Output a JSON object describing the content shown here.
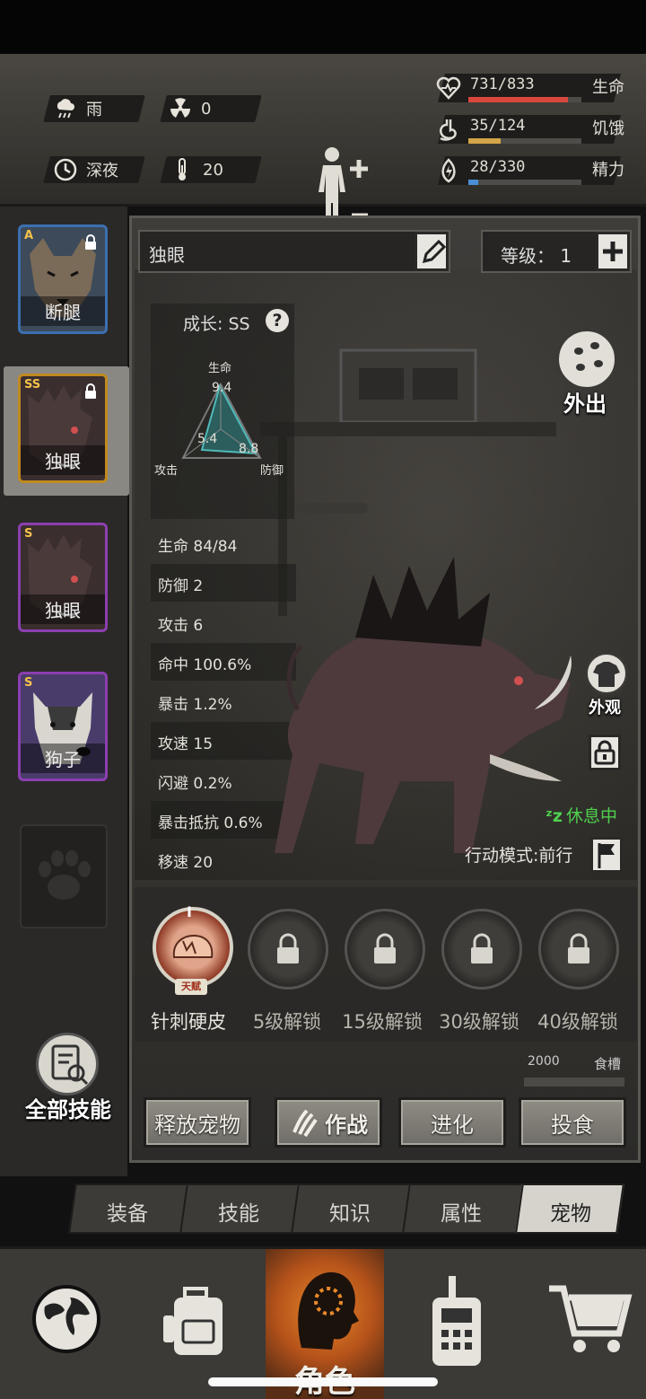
{
  "environment": {
    "weather": "雨",
    "radiation": "0",
    "time": "深夜",
    "temperature": "20"
  },
  "vitals": [
    {
      "value": "731/833",
      "label": "生命",
      "fraction": 0.8776,
      "color": "#d9473d",
      "icon": "heart-icon"
    },
    {
      "value": "35/124",
      "label": "饥饿",
      "fraction": 0.2823,
      "color": "#d4a548",
      "icon": "stomach-icon"
    },
    {
      "value": "28/330",
      "label": "精力",
      "fraction": 0.0848,
      "color": "#4a8fd6",
      "icon": "energy-icon"
    }
  ],
  "pets": [
    {
      "grade": "A",
      "name": "断腿",
      "border": "#3c6fb0",
      "bg": "#3c4a5a"
    },
    {
      "grade": "SS",
      "name": "独眼",
      "border": "#c08a20",
      "bg": "#3a2e2e"
    },
    {
      "grade": "S",
      "name": "独眼",
      "border": "#8c3fb0",
      "bg": "#3a2e2e"
    },
    {
      "grade": "S",
      "name": "狗子",
      "border": "#8c3fb0",
      "bg": "#4a3c6a"
    }
  ],
  "all_skills": "全部技能",
  "pet_name": "独眼",
  "level": "等级： 1",
  "growth": {
    "title": "成长: SS",
    "help": "?",
    "labels": {
      "top": "生命",
      "left": "攻击",
      "right": "防御"
    },
    "values": {
      "top": "9.4",
      "left": "5.4",
      "right": "8.8"
    }
  },
  "stats": [
    "生命 84/84",
    "防御 2",
    "攻击 6",
    "命中 100.6%",
    "暴击 1.2%",
    "攻速 15",
    "闪避 0.2%",
    "暴击抵抗 0.6%",
    "移速 20"
  ],
  "go_out": "外出",
  "appearance": "外观",
  "status": "休息中",
  "action_mode": "行动模式:前行",
  "skills": [
    {
      "label": "针刺硬皮",
      "tag": "天赋",
      "roman": "I"
    },
    {
      "label": "5级解锁"
    },
    {
      "label": "15级解锁"
    },
    {
      "label": "30级解锁"
    },
    {
      "label": "40级解锁"
    }
  ],
  "trough": {
    "value": "2000",
    "label": "食槽"
  },
  "actions": {
    "release": "释放宠物",
    "fight": "作战",
    "evolve": "进化",
    "feed": "投食"
  },
  "tabs": [
    "装备",
    "技能",
    "知识",
    "属性",
    "宠物"
  ],
  "active_tab": "宠物",
  "nav": {
    "character": "角色"
  }
}
